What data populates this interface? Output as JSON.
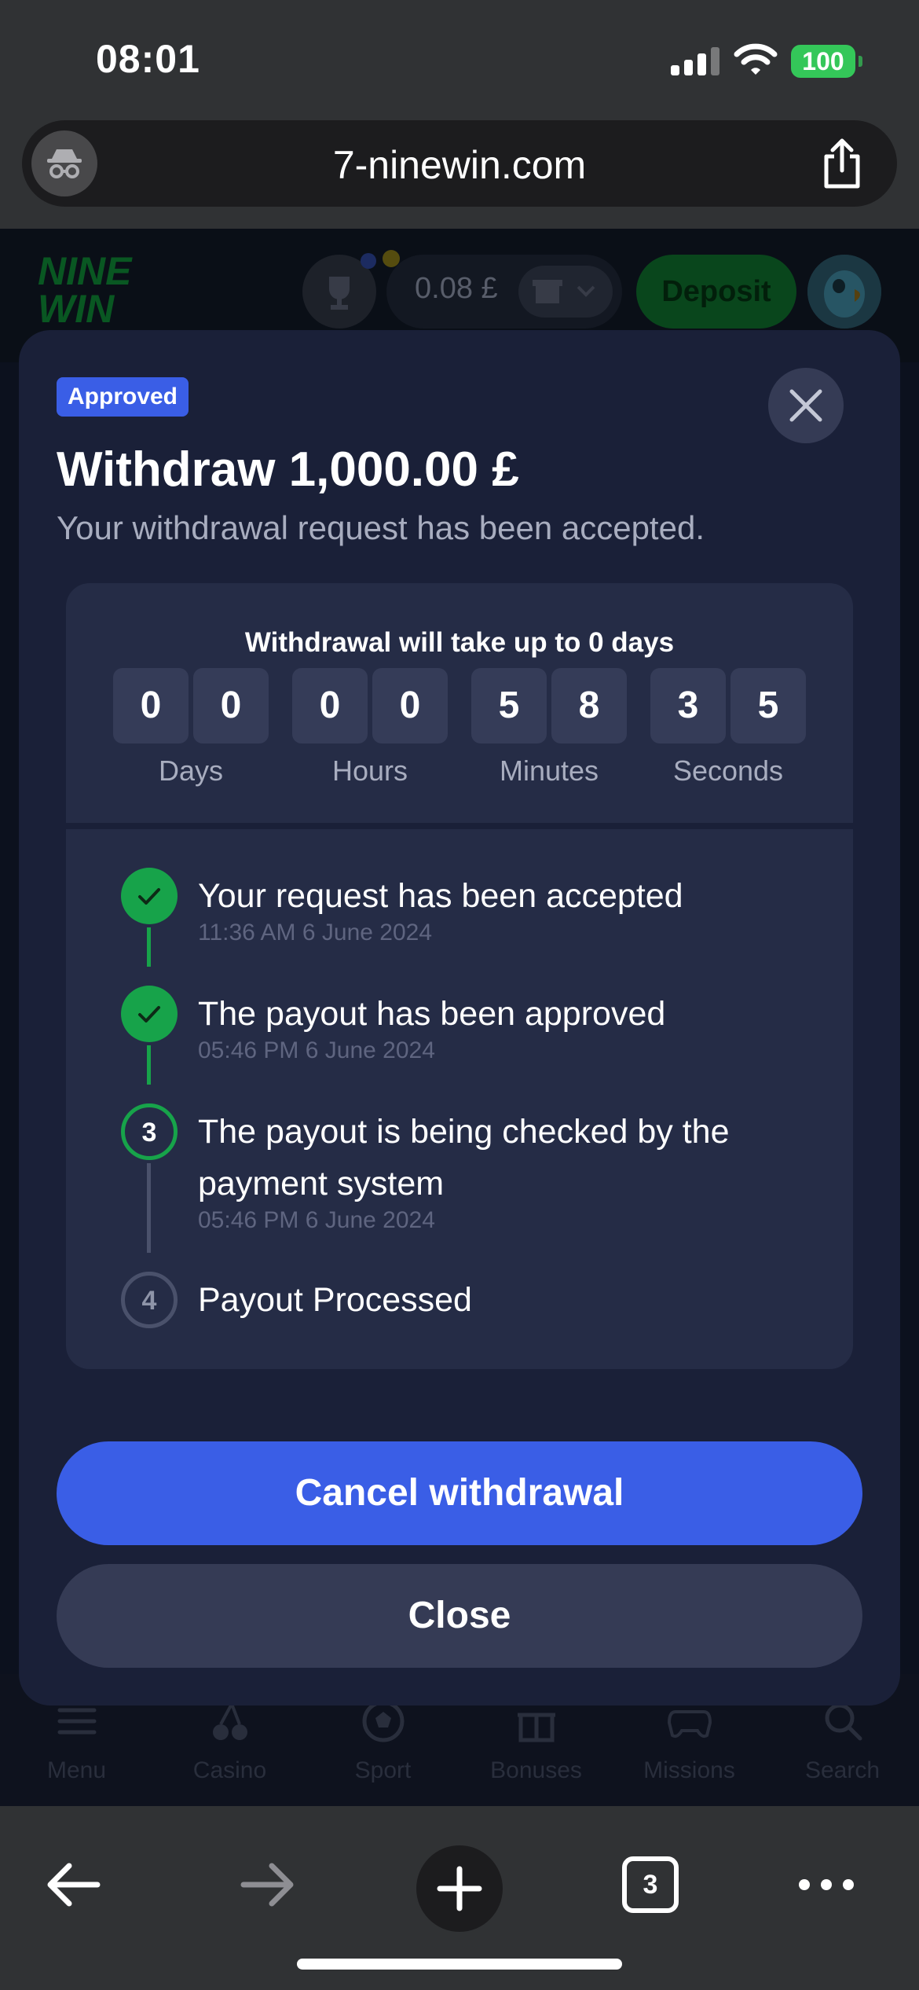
{
  "status_bar": {
    "time": "08:01",
    "battery": "100"
  },
  "browser": {
    "url": "7-ninewin.com",
    "tab_count": "3"
  },
  "site": {
    "logo_line1": "NINE",
    "logo_line2": "WIN",
    "balance": "0.08 £",
    "deposit_label": "Deposit"
  },
  "bottom_nav": {
    "items": [
      {
        "label": "Menu",
        "icon": "menu-icon"
      },
      {
        "label": "Casino",
        "icon": "cherry-icon"
      },
      {
        "label": "Sport",
        "icon": "ball-icon"
      },
      {
        "label": "Bonuses",
        "icon": "gift-icon"
      },
      {
        "label": "Missions",
        "icon": "gamepad-icon"
      },
      {
        "label": "Search",
        "icon": "search-icon"
      }
    ]
  },
  "modal": {
    "badge": "Approved",
    "title": "Withdraw 1,000.00 £",
    "subtitle": "Your withdrawal request has been accepted.",
    "timer_heading": "Withdrawal will take up to 0 days",
    "timer": {
      "days": [
        "0",
        "0"
      ],
      "hours": [
        "0",
        "0"
      ],
      "minutes": [
        "5",
        "8"
      ],
      "seconds": [
        "3",
        "5"
      ],
      "labels": {
        "days": "Days",
        "hours": "Hours",
        "minutes": "Minutes",
        "seconds": "Seconds"
      }
    },
    "steps": [
      {
        "number": "1",
        "status": "done",
        "title": "Your request has been accepted",
        "time": "11:36 AM 6 June 2024"
      },
      {
        "number": "2",
        "status": "done",
        "title": "The payout has been approved",
        "time": "05:46 PM 6 June 2024"
      },
      {
        "number": "3",
        "status": "active",
        "title_line1": "The payout is being checked by the",
        "title_line2": "payment system",
        "time": "05:46 PM 6 June 2024"
      },
      {
        "number": "4",
        "status": "pending",
        "title": "Payout Processed"
      }
    ],
    "cancel_label": "Cancel withdrawal",
    "close_label": "Close"
  },
  "colors": {
    "accent": "#3a5ee6",
    "success": "#17a34a",
    "modal_bg": "#1a2038",
    "card_bg": "#252c46"
  }
}
